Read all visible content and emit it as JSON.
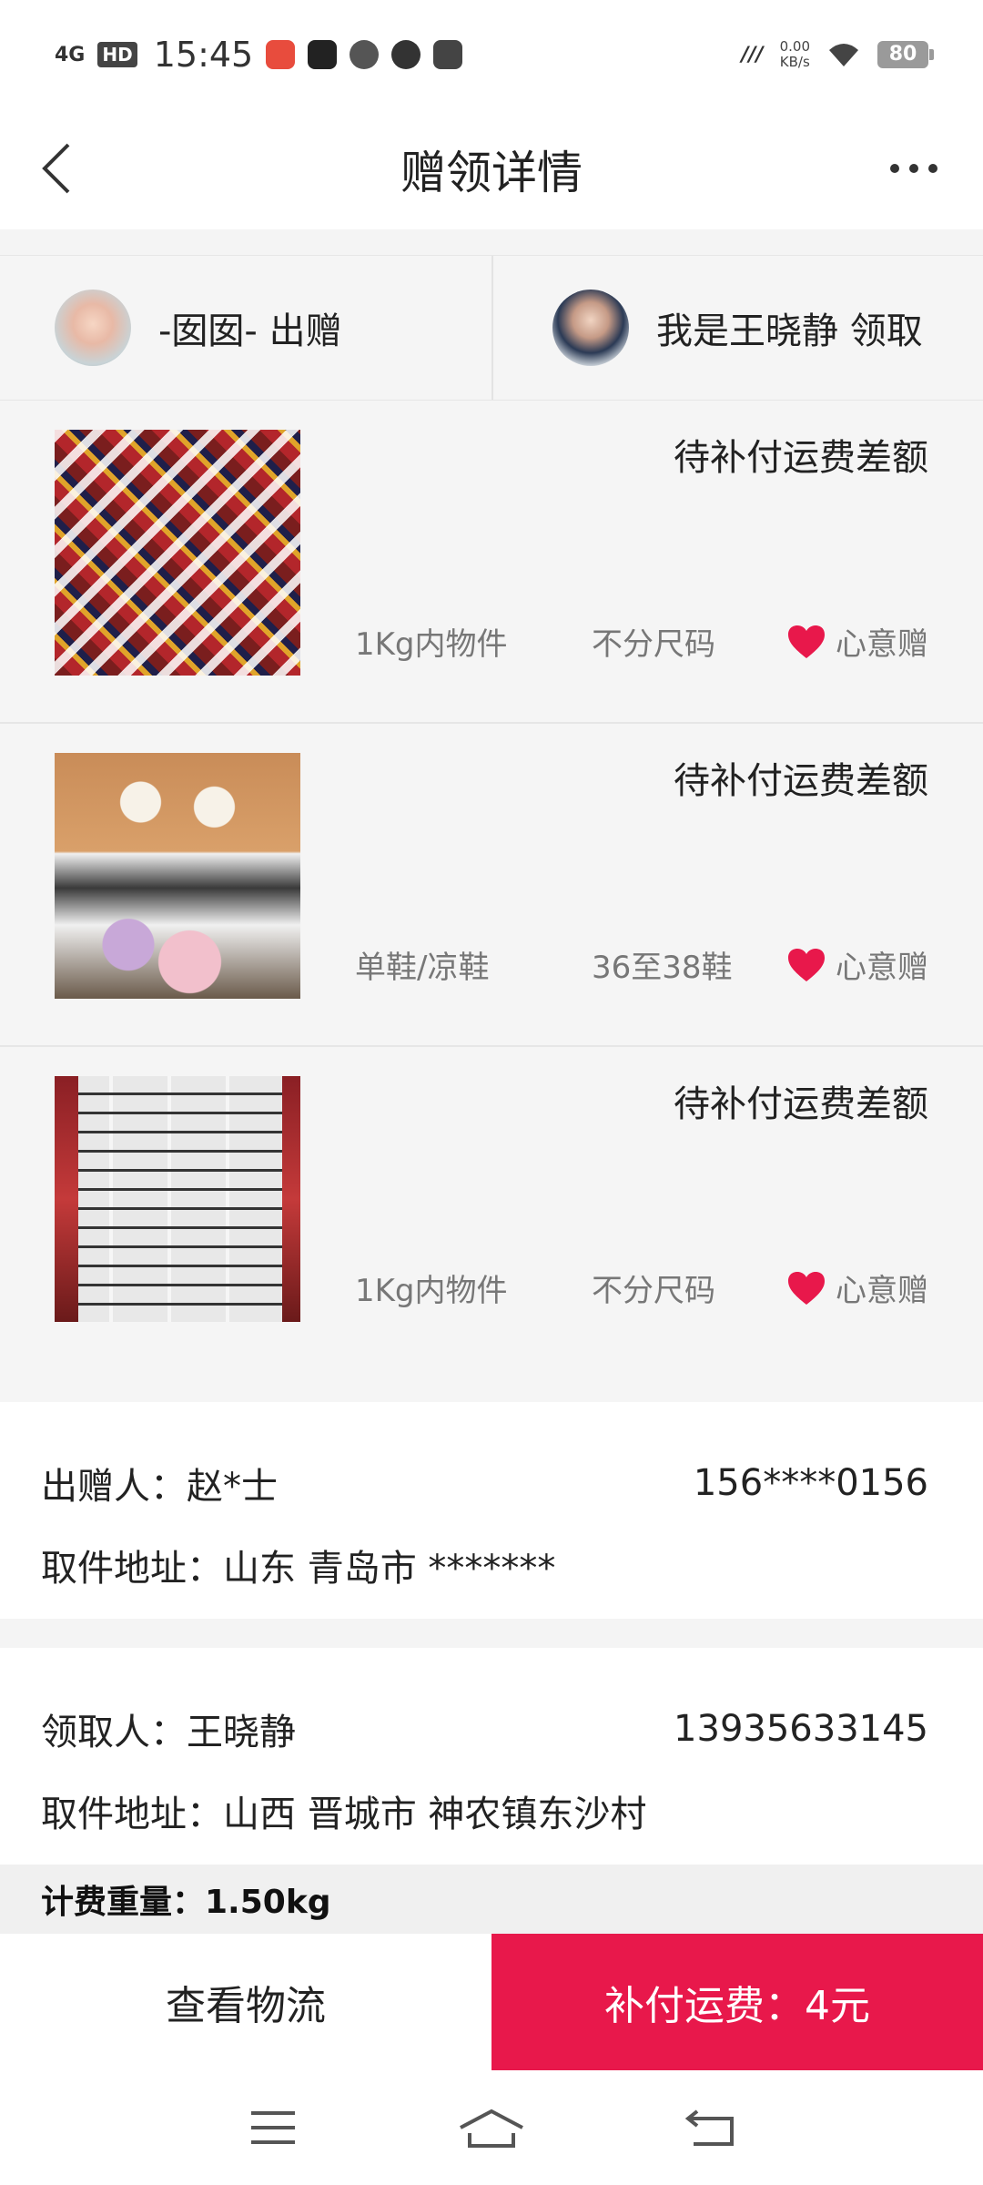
{
  "status_bar": {
    "network": "4G",
    "hd": "HD",
    "time": "15:45",
    "speed_value": "0.00",
    "speed_unit": "KB/s",
    "battery": "80"
  },
  "header": {
    "title": "赠领详情"
  },
  "parties": {
    "giver_text": "-囡囡- 出赠",
    "receiver_text": "我是王晓静 领取"
  },
  "items": [
    {
      "status": "待补付运费差额",
      "category": "1Kg内物件",
      "size": "不分尺码",
      "tag": "心意赠"
    },
    {
      "status": "待补付运费差额",
      "category": "单鞋/凉鞋",
      "size": "36至38鞋",
      "tag": "心意赠"
    },
    {
      "status": "待补付运费差额",
      "category": "1Kg内物件",
      "size": "不分尺码",
      "tag": "心意赠"
    }
  ],
  "giver_info": {
    "name_label": "出赠人：赵*士",
    "phone": "156****0156",
    "address": "取件地址：山东 青岛市 *******"
  },
  "receiver_info": {
    "name_label": "领取人：王晓静",
    "phone": "13935633145",
    "address": "取件地址：山西 晋城市 神农镇东沙村"
  },
  "weight_text": "计费重量：1.50kg",
  "actions": {
    "logistics": "查看物流",
    "pay": "补付运费：4元"
  },
  "colors": {
    "accent": "#e8184b",
    "heart": "#e8184b"
  }
}
